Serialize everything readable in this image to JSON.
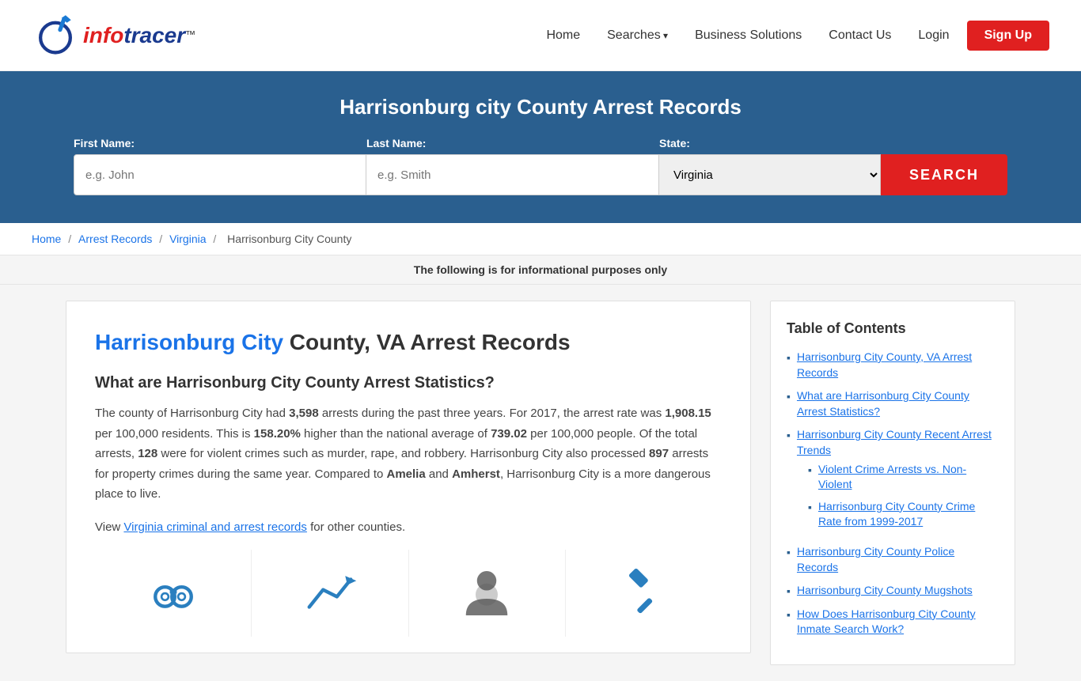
{
  "site": {
    "logo_text_red": "info",
    "logo_text_blue": "tracer",
    "logo_trademark": "™"
  },
  "nav": {
    "home_label": "Home",
    "searches_label": "Searches",
    "business_solutions_label": "Business Solutions",
    "contact_us_label": "Contact Us",
    "login_label": "Login",
    "signup_label": "Sign Up"
  },
  "banner": {
    "title": "Harrisonburg city County Arrest Records"
  },
  "search_form": {
    "first_name_label": "First Name:",
    "first_name_placeholder": "e.g. John",
    "last_name_label": "Last Name:",
    "last_name_placeholder": "e.g. Smith",
    "state_label": "State:",
    "state_value": "Virginia",
    "search_button_label": "SEARCH"
  },
  "breadcrumb": {
    "home": "Home",
    "arrest_records": "Arrest Records",
    "state": "Virginia",
    "county": "Harrisonburg City County"
  },
  "info_banner": "The following is for informational purposes only",
  "content": {
    "heading_blue": "Harrisonburg City",
    "heading_rest": " County, VA Arrest Records",
    "subheading": "What are Harrisonburg City County Arrest Statistics?",
    "paragraph1": "The county of Harrisonburg City had 3,598 arrests during the past three years. For 2017, the arrest rate was 1,908.15 per 100,000 residents. This is 158.20% higher than the national average of 739.02 per 100,000 people. Of the total arrests, 128 were for violent crimes such as murder, rape, and robbery. Harrisonburg City also processed 897 arrests for property crimes during the same year. Compared to Amelia and Amherst, Harrisonburg City is a more dangerous place to live.",
    "paragraph1_bold_values": [
      "3,598",
      "1,908.15",
      "158.20%",
      "739.02",
      "128",
      "897",
      "Amelia",
      "Amherst"
    ],
    "paragraph2_prefix": "View ",
    "paragraph2_link": "Virginia criminal and arrest records",
    "paragraph2_suffix": " for other counties."
  },
  "toc": {
    "heading": "Table of Contents",
    "items": [
      {
        "label": "Harrisonburg City County, VA Arrest Records",
        "sub": []
      },
      {
        "label": "What are Harrisonburg City County Arrest Statistics?",
        "sub": []
      },
      {
        "label": "Harrisonburg City County Recent Arrest Trends",
        "sub": [
          "Violent Crime Arrests vs. Non-Violent",
          "Harrisonburg City County Crime Rate from 1999-2017"
        ]
      },
      {
        "label": "Harrisonburg City County Police Records",
        "sub": []
      },
      {
        "label": "Harrisonburg City County Mugshots",
        "sub": []
      },
      {
        "label": "How Does Harrisonburg City County Inmate Search Work?",
        "sub": []
      }
    ]
  },
  "colors": {
    "red": "#e02020",
    "blue": "#1a73e8",
    "dark_blue": "#2a5f8f",
    "icon_blue": "#2a7fbf"
  }
}
